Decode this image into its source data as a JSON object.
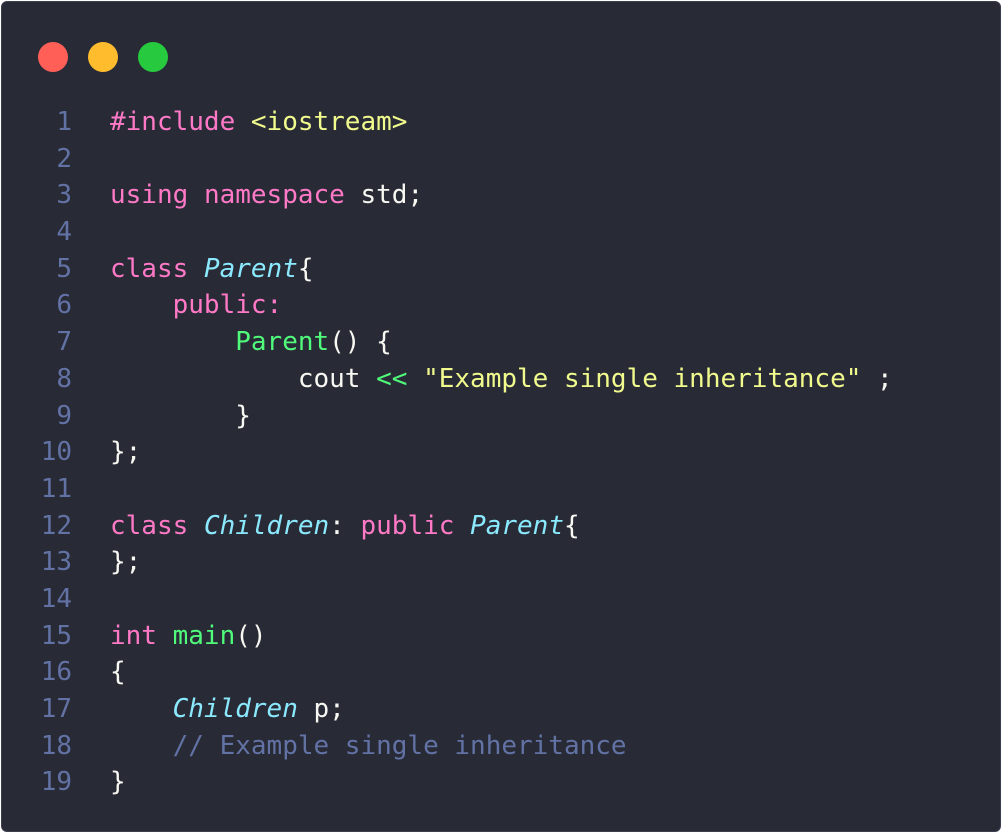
{
  "window": {
    "controls": [
      {
        "name": "close",
        "color": "#ff5f56"
      },
      {
        "name": "minimize",
        "color": "#ffbd2e"
      },
      {
        "name": "maximize",
        "color": "#27c93f"
      }
    ],
    "background": "#282a36"
  },
  "colors": {
    "keyword": "#ff79c6",
    "type": "#8be9fd",
    "function": "#50fa7b",
    "string": "#f1fa8c",
    "comment": "#6272a4",
    "plain": "#f8f8f2",
    "line_number": "#6272a4"
  },
  "code": {
    "language": "cpp",
    "lines": [
      {
        "n": "1",
        "tokens": [
          {
            "t": "#include ",
            "c": "keyword"
          },
          {
            "t": "<iostream>",
            "c": "string"
          }
        ]
      },
      {
        "n": "2",
        "tokens": []
      },
      {
        "n": "3",
        "tokens": [
          {
            "t": "using",
            "c": "keyword"
          },
          {
            "t": " ",
            "c": "plain"
          },
          {
            "t": "namespace",
            "c": "keyword"
          },
          {
            "t": " std;",
            "c": "plain"
          }
        ]
      },
      {
        "n": "4",
        "tokens": []
      },
      {
        "n": "5",
        "tokens": [
          {
            "t": "class",
            "c": "keyword"
          },
          {
            "t": " ",
            "c": "plain"
          },
          {
            "t": "Parent",
            "c": "type",
            "i": true
          },
          {
            "t": "{",
            "c": "plain"
          }
        ]
      },
      {
        "n": "6",
        "tokens": [
          {
            "t": "    ",
            "c": "plain"
          },
          {
            "t": "public:",
            "c": "keyword"
          }
        ]
      },
      {
        "n": "7",
        "tokens": [
          {
            "t": "        ",
            "c": "plain"
          },
          {
            "t": "Parent",
            "c": "function"
          },
          {
            "t": "() {",
            "c": "plain"
          }
        ]
      },
      {
        "n": "8",
        "tokens": [
          {
            "t": "            cout ",
            "c": "plain"
          },
          {
            "t": "<<",
            "c": "function"
          },
          {
            "t": " ",
            "c": "plain"
          },
          {
            "t": "\"Example single inheritance\"",
            "c": "string"
          },
          {
            "t": " ;",
            "c": "plain"
          }
        ]
      },
      {
        "n": "9",
        "tokens": [
          {
            "t": "        }",
            "c": "plain"
          }
        ]
      },
      {
        "n": "10",
        "tokens": [
          {
            "t": "};",
            "c": "plain"
          }
        ]
      },
      {
        "n": "11",
        "tokens": []
      },
      {
        "n": "12",
        "tokens": [
          {
            "t": "class",
            "c": "keyword"
          },
          {
            "t": " ",
            "c": "plain"
          },
          {
            "t": "Children",
            "c": "type",
            "i": true
          },
          {
            "t": ": ",
            "c": "plain"
          },
          {
            "t": "public",
            "c": "keyword"
          },
          {
            "t": " ",
            "c": "plain"
          },
          {
            "t": "Parent",
            "c": "type",
            "i": true
          },
          {
            "t": "{",
            "c": "plain"
          }
        ]
      },
      {
        "n": "13",
        "tokens": [
          {
            "t": "};",
            "c": "plain"
          }
        ]
      },
      {
        "n": "14",
        "tokens": []
      },
      {
        "n": "15",
        "tokens": [
          {
            "t": "int",
            "c": "keyword"
          },
          {
            "t": " ",
            "c": "plain"
          },
          {
            "t": "main",
            "c": "function"
          },
          {
            "t": "()",
            "c": "plain"
          }
        ]
      },
      {
        "n": "16",
        "tokens": [
          {
            "t": "{",
            "c": "plain"
          }
        ]
      },
      {
        "n": "17",
        "tokens": [
          {
            "t": "    ",
            "c": "plain"
          },
          {
            "t": "Children",
            "c": "type",
            "i": true
          },
          {
            "t": " p;",
            "c": "plain"
          }
        ]
      },
      {
        "n": "18",
        "tokens": [
          {
            "t": "    ",
            "c": "plain"
          },
          {
            "t": "// Example single inheritance",
            "c": "comment"
          }
        ]
      },
      {
        "n": "19",
        "tokens": [
          {
            "t": "}",
            "c": "plain"
          }
        ]
      }
    ]
  }
}
